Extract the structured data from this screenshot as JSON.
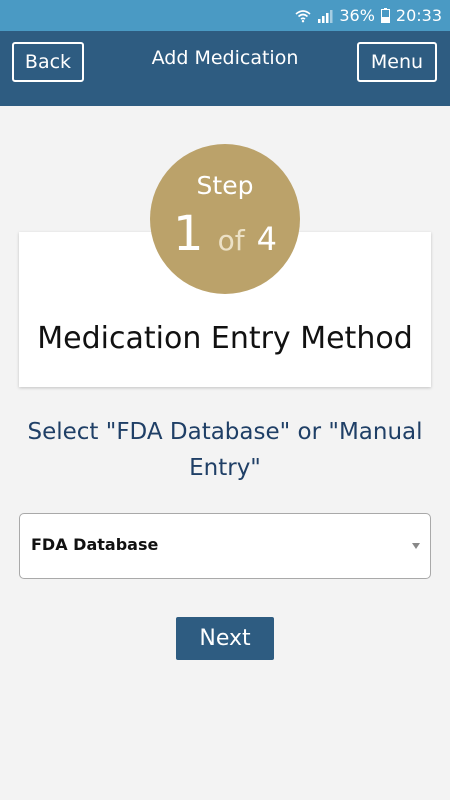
{
  "status_bar": {
    "battery_percent": "36%",
    "time": "20:33",
    "icons": [
      "wifi-icon",
      "signal-icon",
      "battery-icon"
    ]
  },
  "header": {
    "back_label": "Back",
    "title": "Add Medication",
    "menu_label": "Menu"
  },
  "step": {
    "label": "Step",
    "current": "1",
    "of_word": "of",
    "total": "4"
  },
  "card": {
    "title": "Medication Entry Method"
  },
  "instruction": "Select \"FDA Database\" or \"Manual Entry\"",
  "entry_method": {
    "selected": "FDA Database",
    "options": [
      "FDA Database"
    ]
  },
  "next_label": "Next",
  "colors": {
    "status_bar": "#4a9ac4",
    "header": "#2e5c81",
    "step_circle": "#bba26a",
    "instruction_text": "#1f3f66",
    "background": "#f3f3f3"
  }
}
